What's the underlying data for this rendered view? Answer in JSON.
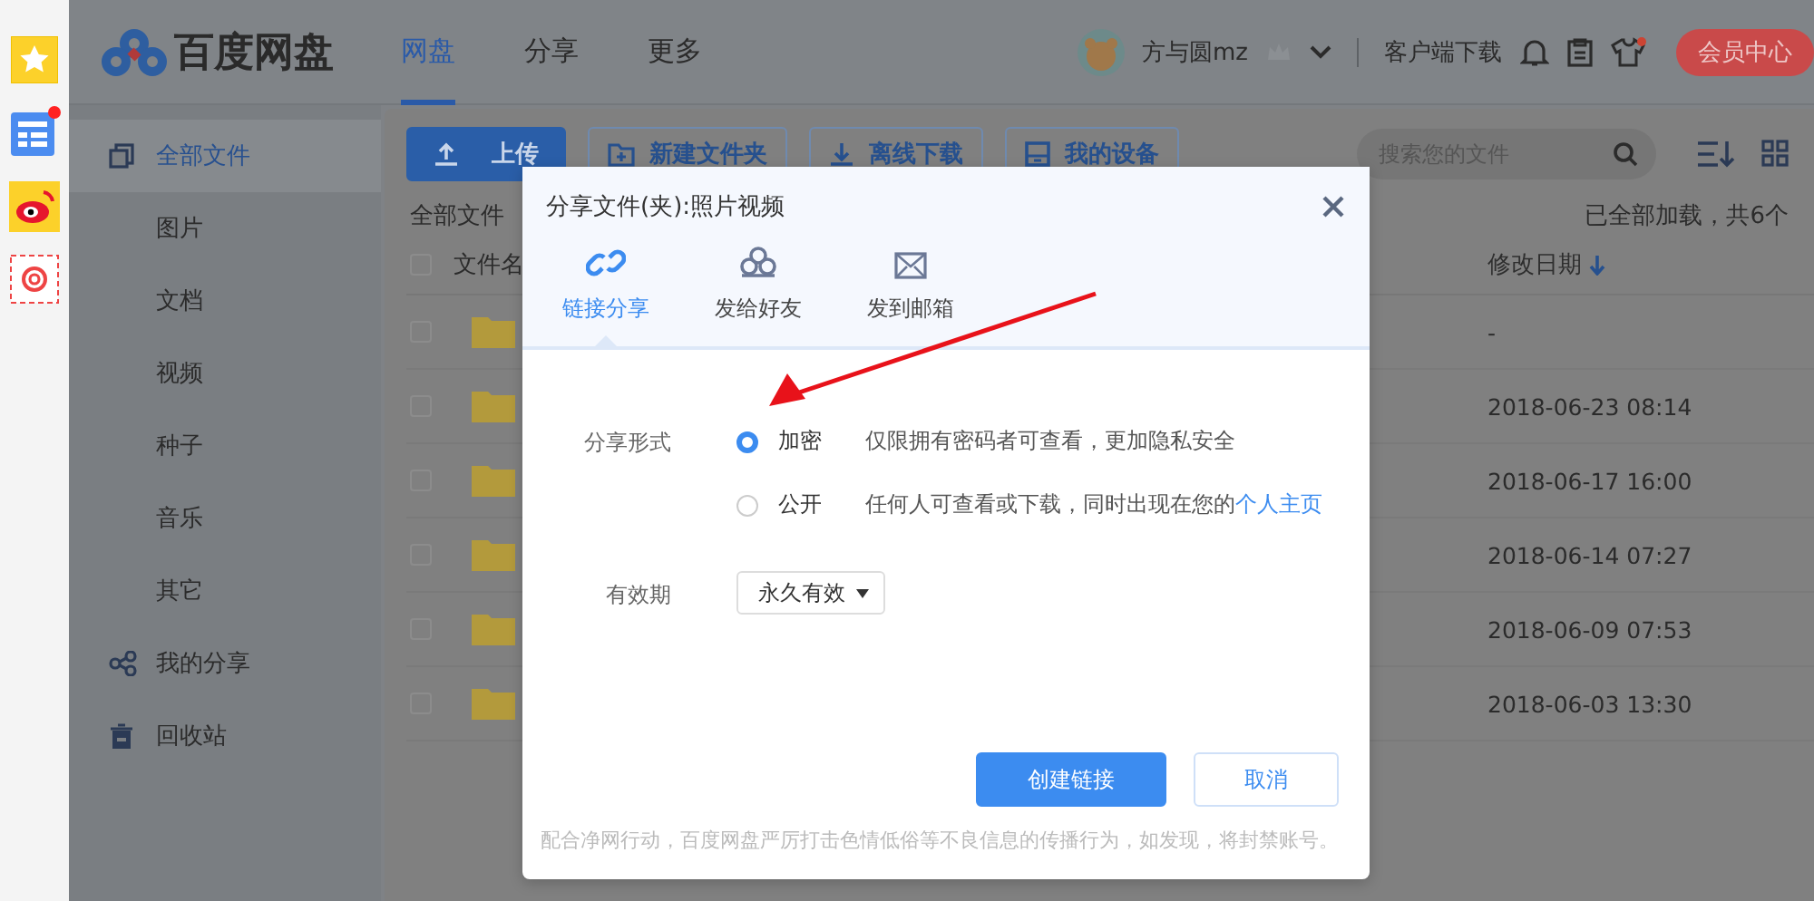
{
  "logo": {
    "text": "百度网盘"
  },
  "nav": [
    {
      "label": "网盘",
      "selected": true
    },
    {
      "label": "分享",
      "selected": false
    },
    {
      "label": "更多",
      "selected": false
    }
  ],
  "user": {
    "name": "方与圆mz",
    "client_download": "客户端下载",
    "vip_button": "会员中心"
  },
  "sidebar": {
    "items": [
      {
        "label": "全部文件",
        "selected": true
      },
      {
        "label": "图片",
        "selected": false
      },
      {
        "label": "文档",
        "selected": false
      },
      {
        "label": "视频",
        "selected": false
      },
      {
        "label": "种子",
        "selected": false
      },
      {
        "label": "音乐",
        "selected": false
      },
      {
        "label": "其它",
        "selected": false
      },
      {
        "label": "我的分享",
        "selected": false
      },
      {
        "label": "回收站",
        "selected": false
      }
    ]
  },
  "toolbar": {
    "buttons": [
      {
        "label": "上传",
        "kind": "upload"
      },
      {
        "label": "新建文件夹",
        "kind": "folder"
      },
      {
        "label": "离线下载",
        "kind": "download"
      },
      {
        "label": "我的设备",
        "kind": "device"
      }
    ],
    "search": {
      "placeholder": "搜索您的文件"
    }
  },
  "breadcrumb": "全部文件",
  "load_status": "已全部加载，共6个",
  "table": {
    "columns": [
      "文件名",
      "修改日期"
    ],
    "select_all": {
      "checked": false
    },
    "rows": [
      {
        "date": "-",
        "checked": false
      },
      {
        "date": "2018-06-23 08:14",
        "checked": false
      },
      {
        "date": "2018-06-17 16:00",
        "checked": false
      },
      {
        "date": "2018-06-14 07:27",
        "checked": false
      },
      {
        "date": "2018-06-09 07:53",
        "checked": false
      },
      {
        "date": "2018-06-03 13:30",
        "checked": false
      }
    ]
  },
  "dialog": {
    "title": "分享文件(夹):照片视频",
    "tabs": [
      {
        "label": "链接分享",
        "selected": true
      },
      {
        "label": "发给好友",
        "selected": false
      },
      {
        "label": "发到邮箱",
        "selected": false
      }
    ],
    "share_form": {
      "label": "分享形式",
      "options": [
        {
          "label": "加密",
          "selected": true,
          "description": "仅限拥有密码者可查看，更加隐私安全"
        },
        {
          "label": "公开",
          "selected": false,
          "description": "任何人可查看或下载，同时出现在您的",
          "link": "个人主页"
        }
      ]
    },
    "validity": {
      "label": "有效期",
      "value": "永久有效"
    },
    "buttons": [
      {
        "label": "创建链接",
        "kind": "primary"
      },
      {
        "label": "取消",
        "kind": "secondary"
      }
    ],
    "notice": "配合净网行动，百度网盘严厉打击色情低俗等不良信息的传播行为，如发现，将封禁账号。"
  }
}
